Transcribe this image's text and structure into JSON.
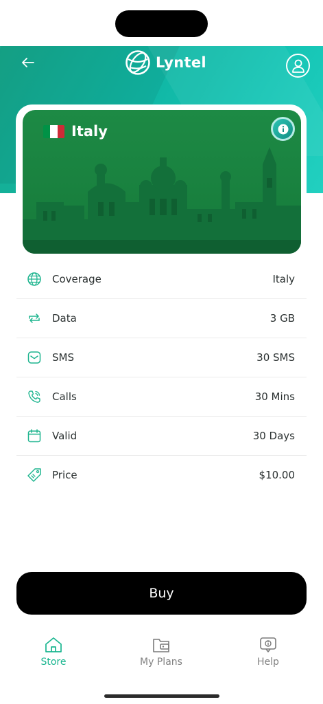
{
  "app": {
    "brand_name": "Lyntel"
  },
  "header": {
    "back_icon": "arrow-left-icon",
    "logo_icon": "globe-icon",
    "profile_icon": "user-icon"
  },
  "card": {
    "country": "Italy",
    "flag_colors": [
      "#009246",
      "#ffffff",
      "#ce2b37"
    ],
    "info_icon": "info-icon"
  },
  "details": [
    {
      "icon": "globe-icon",
      "label": "Coverage",
      "value": "Italy"
    },
    {
      "icon": "data-transfer-icon",
      "label": "Data",
      "value": "3 GB"
    },
    {
      "icon": "message-icon",
      "label": "SMS",
      "value": "30 SMS"
    },
    {
      "icon": "phone-call-icon",
      "label": "Calls",
      "value": "30 Mins"
    },
    {
      "icon": "calendar-icon",
      "label": "Valid",
      "value": "30 Days"
    },
    {
      "icon": "price-tag-icon",
      "label": "Price",
      "value": "$10.00"
    }
  ],
  "buy": {
    "label": "Buy"
  },
  "nav": {
    "store": "Store",
    "plans": "My Plans",
    "help": "Help"
  },
  "colors": {
    "accent": "#19b58f",
    "card_green": "#1d8a45",
    "nav_inactive": "#808080"
  }
}
